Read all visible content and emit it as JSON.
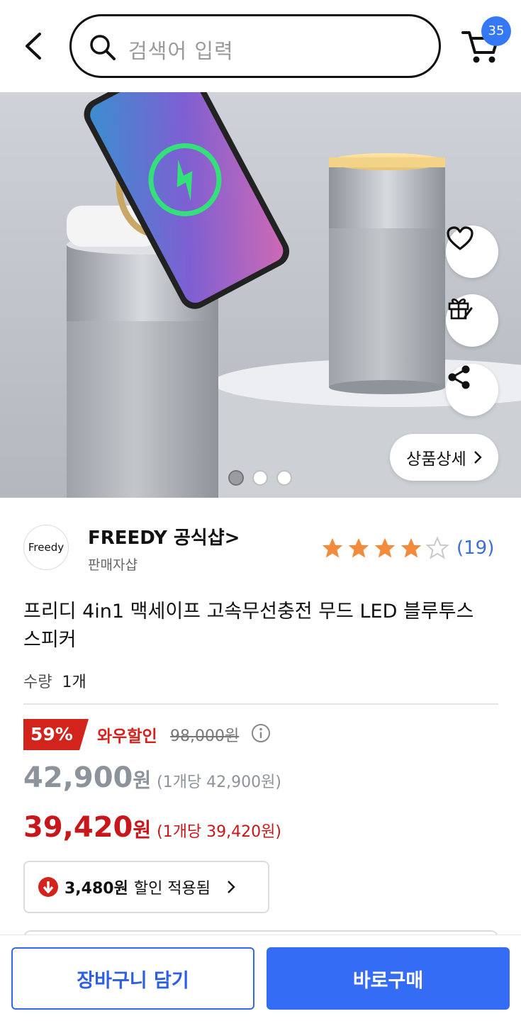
{
  "header": {
    "search_placeholder": "검색어 입력",
    "cart_count": "35"
  },
  "product_image": {
    "detail_label": "상품상세",
    "slide_count": 3,
    "active_slide": 1
  },
  "seller": {
    "logo_text": "Freedy",
    "name": "FREEDY 공식샵>",
    "type": "판매자샵"
  },
  "rating": {
    "stars": 4,
    "max_stars": 5,
    "review_count": "(19)"
  },
  "product": {
    "title": "프리디 4in1 맥세이프 고속무선충전 무드 LED 블루투스 스피커",
    "quantity_label": "수량",
    "quantity_value": "1개"
  },
  "pricing": {
    "discount_rate": "59%",
    "wow_label": "와우할인",
    "original_price": "98,000원",
    "price_number": "42,900",
    "price_won": "원",
    "price_unit": "(1개당 42,900원)",
    "wow_price_number": "39,420",
    "wow_price_won": "원",
    "wow_price_unit": "(1개당 39,420원)",
    "coupon_amount": "3,480원",
    "coupon_text": "할인 적용됨"
  },
  "actions": {
    "add_to_cart": "장바구니 담기",
    "buy_now": "바로구매"
  },
  "colors": {
    "accent": "#356cf5",
    "sale_red": "#d2231d",
    "star": "#f28b3c"
  }
}
